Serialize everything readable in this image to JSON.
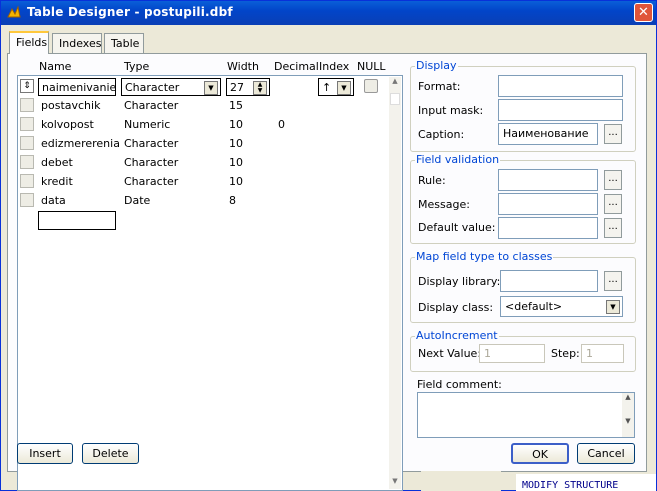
{
  "window": {
    "title": "Table Designer - postupili.dbf",
    "close_glyph": "✕"
  },
  "tabs": [
    {
      "label": "Fields"
    },
    {
      "label": "Indexes"
    },
    {
      "label": "Table"
    }
  ],
  "grid": {
    "headers": {
      "name": "Name",
      "type": "Type",
      "width": "Width",
      "decimal": "Decimal",
      "index": "Index",
      "null": "NULL"
    },
    "active_row": {
      "name": "naimenivanie",
      "type": "Character",
      "width": "27",
      "index": "↑"
    },
    "rows": [
      {
        "name": "postavchik",
        "type": "Character",
        "width": "15",
        "decimal": ""
      },
      {
        "name": "kolvopost",
        "type": "Numeric",
        "width": "10",
        "decimal": "0"
      },
      {
        "name": "edizmererenia",
        "type": "Character",
        "width": "10",
        "decimal": ""
      },
      {
        "name": "debet",
        "type": "Character",
        "width": "10",
        "decimal": ""
      },
      {
        "name": "kredit",
        "type": "Character",
        "width": "10",
        "decimal": ""
      },
      {
        "name": "data",
        "type": "Date",
        "width": "8",
        "decimal": ""
      }
    ]
  },
  "display": {
    "legend": "Display",
    "format_label": "Format:",
    "input_mask_label": "Input mask:",
    "caption_label": "Caption:",
    "caption_value": "Наименование"
  },
  "validation": {
    "legend": "Field validation",
    "rule_label": "Rule:",
    "message_label": "Message:",
    "default_label": "Default value:"
  },
  "mapping": {
    "legend": "Map field type to classes",
    "library_label": "Display library:",
    "class_label": "Display class:",
    "class_value": "<default>"
  },
  "autoinc": {
    "legend": "AutoIncrement",
    "next_label": "Next Value:",
    "next_value": "1",
    "step_label": "Step:",
    "step_value": "1"
  },
  "comment": {
    "label": "Field comment:"
  },
  "buttons": {
    "insert": "Insert",
    "delete": "Delete",
    "ok": "OK",
    "cancel": "Cancel",
    "dots": "..."
  },
  "background_text": "MODIFY STRUCTURE",
  "colors": {
    "title_bar": "#0245c9",
    "group_label": "#0046d5"
  }
}
